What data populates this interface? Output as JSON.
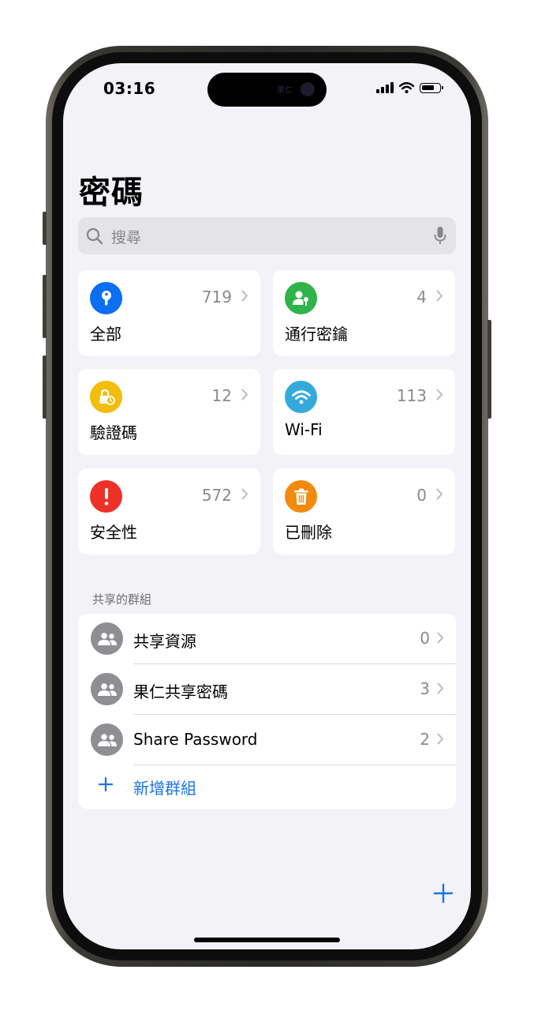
{
  "status": {
    "time": "03:16",
    "island_text": "果仁"
  },
  "header": {
    "title": "密碼"
  },
  "search": {
    "placeholder": "搜尋"
  },
  "categories": [
    {
      "label": "全部",
      "count": "719",
      "icon": "key-icon",
      "color": "#0a6ff2"
    },
    {
      "label": "通行密鑰",
      "count": "4",
      "icon": "person-key-icon",
      "color": "#2fb34a"
    },
    {
      "label": "驗證碼",
      "count": "12",
      "icon": "lock-clock-icon",
      "color": "#f2bd0d"
    },
    {
      "label": "Wi-Fi",
      "count": "113",
      "icon": "wifi-icon",
      "color": "#34aadc"
    },
    {
      "label": "安全性",
      "count": "572",
      "icon": "exclamation-icon",
      "color": "#ee3127"
    },
    {
      "label": "已刪除",
      "count": "0",
      "icon": "trash-icon",
      "color": "#f28a0d"
    }
  ],
  "groups": {
    "header": "共享的群組",
    "items": [
      {
        "label": "共享資源",
        "count": "0",
        "icon": "group-people-icon"
      },
      {
        "label": "果仁共享密碼",
        "count": "3",
        "icon": "group-people-icon"
      },
      {
        "label": "Share Password",
        "count": "2",
        "icon": "group-people-icon"
      }
    ],
    "new_group_label": "新增群組"
  },
  "colors": {
    "accent": "#1a73e8",
    "background": "#f2f2f7",
    "group_avatar": "#8e8e93"
  }
}
